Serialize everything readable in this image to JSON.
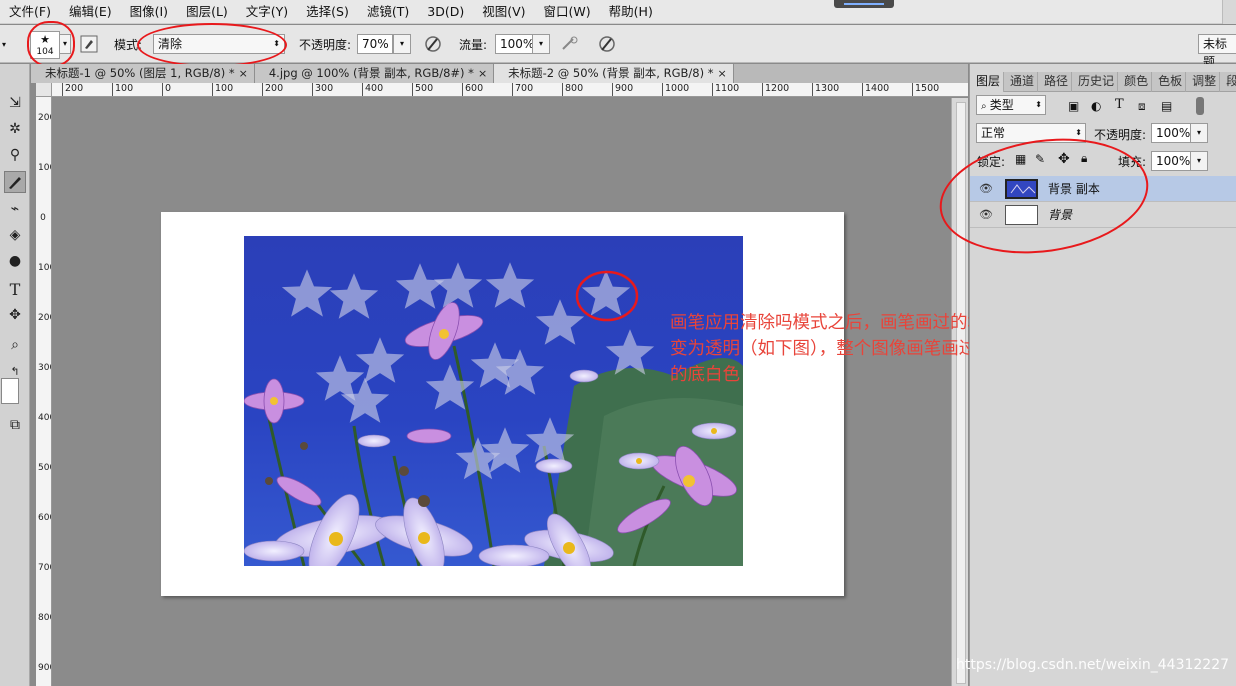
{
  "menubar": {
    "items": [
      "文件(F)",
      "编辑(E)",
      "图像(I)",
      "图层(L)",
      "文字(Y)",
      "选择(S)",
      "滤镜(T)",
      "3D(D)",
      "视图(V)",
      "窗口(W)",
      "帮助(H)"
    ]
  },
  "options": {
    "brush_size": "104",
    "mode_label": "模式:",
    "mode_value": "清除",
    "opacity_label": "不透明度:",
    "opacity_value": "70%",
    "flow_label": "流量:",
    "flow_value": "100%",
    "workspace_right": "未标题"
  },
  "tabs": [
    "未标题-1 @ 50% (图层 1, RGB/8) *",
    "4.jpg @ 100% (背景 副本, RGB/8#) *",
    "未标题-2 @ 50% (背景 副本, RGB/8) *"
  ],
  "tab_close": "×",
  "ruler_top": [
    "200",
    "100",
    "0",
    "100",
    "200",
    "300",
    "400",
    "500",
    "600",
    "700",
    "800",
    "900",
    "1000",
    "1100",
    "1200",
    "1300",
    "1400",
    "1500"
  ],
  "ruler_left": [
    "200",
    "100",
    "0",
    "100",
    "200",
    "300",
    "400",
    "500",
    "600",
    "700",
    "800",
    "900"
  ],
  "annotation": {
    "lines": [
      "画笔应用清除吗模式之后，画笔画过的地方，背景副本图层",
      "变为透明（如下图），整个图像画笔画过的地方为背景图层",
      "的底白色"
    ]
  },
  "layers_panel": {
    "tabs": [
      "图层",
      "通道",
      "路径",
      "历史记",
      "颜色",
      "色板",
      "调整",
      "段落"
    ],
    "filter_label": "类型",
    "blend_mode": "正常",
    "opacity_label": "不透明度:",
    "opacity_value": "100%",
    "lock_label": "锁定:",
    "fill_label": "填充:",
    "fill_value": "100%",
    "layers": [
      {
        "name": "背景 副本",
        "selected": true
      },
      {
        "name": "背景",
        "selected": false
      }
    ]
  },
  "watermark": "https://blog.csdn.net/weixin_44312227",
  "colors": {
    "accent_annotation": "#e8191c",
    "layer_selected": "#b7c9e6",
    "photo_sky": "#2a3db5"
  },
  "icons": [
    "brush-preset-icon",
    "brush-panel-toggle-icon",
    "airbrush-pressure-icon",
    "airbrush-flow-icon",
    "tablet-pressure-icon",
    "eye-icon",
    "lock-icon",
    "move-icon",
    "brush-tool-icon"
  ]
}
